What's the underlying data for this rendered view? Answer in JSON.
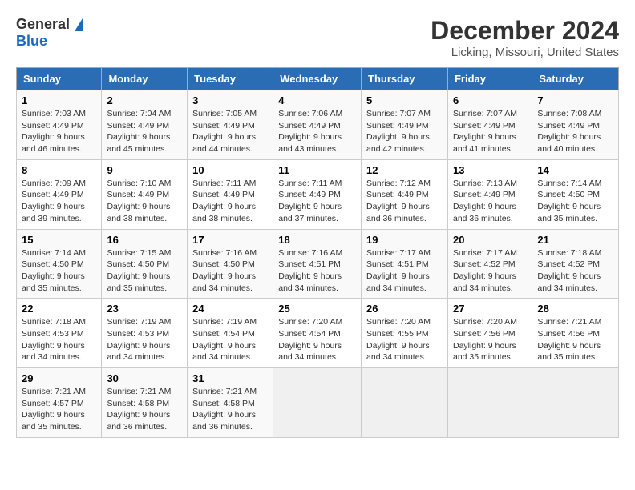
{
  "header": {
    "logo_general": "General",
    "logo_blue": "Blue",
    "title": "December 2024",
    "subtitle": "Licking, Missouri, United States"
  },
  "calendar": {
    "days_of_week": [
      "Sunday",
      "Monday",
      "Tuesday",
      "Wednesday",
      "Thursday",
      "Friday",
      "Saturday"
    ],
    "weeks": [
      [
        null,
        null,
        null,
        null,
        null,
        null,
        null
      ]
    ]
  },
  "cells": {
    "day1": {
      "num": "1",
      "rise": "Sunrise: 7:03 AM",
      "set": "Sunset: 4:49 PM",
      "day": "Daylight: 9 hours",
      "daymin": "and 46 minutes."
    },
    "day2": {
      "num": "2",
      "rise": "Sunrise: 7:04 AM",
      "set": "Sunset: 4:49 PM",
      "day": "Daylight: 9 hours",
      "daymin": "and 45 minutes."
    },
    "day3": {
      "num": "3",
      "rise": "Sunrise: 7:05 AM",
      "set": "Sunset: 4:49 PM",
      "day": "Daylight: 9 hours",
      "daymin": "and 44 minutes."
    },
    "day4": {
      "num": "4",
      "rise": "Sunrise: 7:06 AM",
      "set": "Sunset: 4:49 PM",
      "day": "Daylight: 9 hours",
      "daymin": "and 43 minutes."
    },
    "day5": {
      "num": "5",
      "rise": "Sunrise: 7:07 AM",
      "set": "Sunset: 4:49 PM",
      "day": "Daylight: 9 hours",
      "daymin": "and 42 minutes."
    },
    "day6": {
      "num": "6",
      "rise": "Sunrise: 7:07 AM",
      "set": "Sunset: 4:49 PM",
      "day": "Daylight: 9 hours",
      "daymin": "and 41 minutes."
    },
    "day7": {
      "num": "7",
      "rise": "Sunrise: 7:08 AM",
      "set": "Sunset: 4:49 PM",
      "day": "Daylight: 9 hours",
      "daymin": "and 40 minutes."
    },
    "day8": {
      "num": "8",
      "rise": "Sunrise: 7:09 AM",
      "set": "Sunset: 4:49 PM",
      "day": "Daylight: 9 hours",
      "daymin": "and 39 minutes."
    },
    "day9": {
      "num": "9",
      "rise": "Sunrise: 7:10 AM",
      "set": "Sunset: 4:49 PM",
      "day": "Daylight: 9 hours",
      "daymin": "and 38 minutes."
    },
    "day10": {
      "num": "10",
      "rise": "Sunrise: 7:11 AM",
      "set": "Sunset: 4:49 PM",
      "day": "Daylight: 9 hours",
      "daymin": "and 38 minutes."
    },
    "day11": {
      "num": "11",
      "rise": "Sunrise: 7:11 AM",
      "set": "Sunset: 4:49 PM",
      "day": "Daylight: 9 hours",
      "daymin": "and 37 minutes."
    },
    "day12": {
      "num": "12",
      "rise": "Sunrise: 7:12 AM",
      "set": "Sunset: 4:49 PM",
      "day": "Daylight: 9 hours",
      "daymin": "and 36 minutes."
    },
    "day13": {
      "num": "13",
      "rise": "Sunrise: 7:13 AM",
      "set": "Sunset: 4:49 PM",
      "day": "Daylight: 9 hours",
      "daymin": "and 36 minutes."
    },
    "day14": {
      "num": "14",
      "rise": "Sunrise: 7:14 AM",
      "set": "Sunset: 4:50 PM",
      "day": "Daylight: 9 hours",
      "daymin": "and 35 minutes."
    },
    "day15": {
      "num": "15",
      "rise": "Sunrise: 7:14 AM",
      "set": "Sunset: 4:50 PM",
      "day": "Daylight: 9 hours",
      "daymin": "and 35 minutes."
    },
    "day16": {
      "num": "16",
      "rise": "Sunrise: 7:15 AM",
      "set": "Sunset: 4:50 PM",
      "day": "Daylight: 9 hours",
      "daymin": "and 35 minutes."
    },
    "day17": {
      "num": "17",
      "rise": "Sunrise: 7:16 AM",
      "set": "Sunset: 4:50 PM",
      "day": "Daylight: 9 hours",
      "daymin": "and 34 minutes."
    },
    "day18": {
      "num": "18",
      "rise": "Sunrise: 7:16 AM",
      "set": "Sunset: 4:51 PM",
      "day": "Daylight: 9 hours",
      "daymin": "and 34 minutes."
    },
    "day19": {
      "num": "19",
      "rise": "Sunrise: 7:17 AM",
      "set": "Sunset: 4:51 PM",
      "day": "Daylight: 9 hours",
      "daymin": "and 34 minutes."
    },
    "day20": {
      "num": "20",
      "rise": "Sunrise: 7:17 AM",
      "set": "Sunset: 4:52 PM",
      "day": "Daylight: 9 hours",
      "daymin": "and 34 minutes."
    },
    "day21": {
      "num": "21",
      "rise": "Sunrise: 7:18 AM",
      "set": "Sunset: 4:52 PM",
      "day": "Daylight: 9 hours",
      "daymin": "and 34 minutes."
    },
    "day22": {
      "num": "22",
      "rise": "Sunrise: 7:18 AM",
      "set": "Sunset: 4:53 PM",
      "day": "Daylight: 9 hours",
      "daymin": "and 34 minutes."
    },
    "day23": {
      "num": "23",
      "rise": "Sunrise: 7:19 AM",
      "set": "Sunset: 4:53 PM",
      "day": "Daylight: 9 hours",
      "daymin": "and 34 minutes."
    },
    "day24": {
      "num": "24",
      "rise": "Sunrise: 7:19 AM",
      "set": "Sunset: 4:54 PM",
      "day": "Daylight: 9 hours",
      "daymin": "and 34 minutes."
    },
    "day25": {
      "num": "25",
      "rise": "Sunrise: 7:20 AM",
      "set": "Sunset: 4:54 PM",
      "day": "Daylight: 9 hours",
      "daymin": "and 34 minutes."
    },
    "day26": {
      "num": "26",
      "rise": "Sunrise: 7:20 AM",
      "set": "Sunset: 4:55 PM",
      "day": "Daylight: 9 hours",
      "daymin": "and 34 minutes."
    },
    "day27": {
      "num": "27",
      "rise": "Sunrise: 7:20 AM",
      "set": "Sunset: 4:56 PM",
      "day": "Daylight: 9 hours",
      "daymin": "and 35 minutes."
    },
    "day28": {
      "num": "28",
      "rise": "Sunrise: 7:21 AM",
      "set": "Sunset: 4:56 PM",
      "day": "Daylight: 9 hours",
      "daymin": "and 35 minutes."
    },
    "day29": {
      "num": "29",
      "rise": "Sunrise: 7:21 AM",
      "set": "Sunset: 4:57 PM",
      "day": "Daylight: 9 hours",
      "daymin": "and 35 minutes."
    },
    "day30": {
      "num": "30",
      "rise": "Sunrise: 7:21 AM",
      "set": "Sunset: 4:58 PM",
      "day": "Daylight: 9 hours",
      "daymin": "and 36 minutes."
    },
    "day31": {
      "num": "31",
      "rise": "Sunrise: 7:21 AM",
      "set": "Sunset: 4:58 PM",
      "day": "Daylight: 9 hours",
      "daymin": "and 36 minutes."
    }
  },
  "days_of_week": {
    "sun": "Sunday",
    "mon": "Monday",
    "tue": "Tuesday",
    "wed": "Wednesday",
    "thu": "Thursday",
    "fri": "Friday",
    "sat": "Saturday"
  }
}
